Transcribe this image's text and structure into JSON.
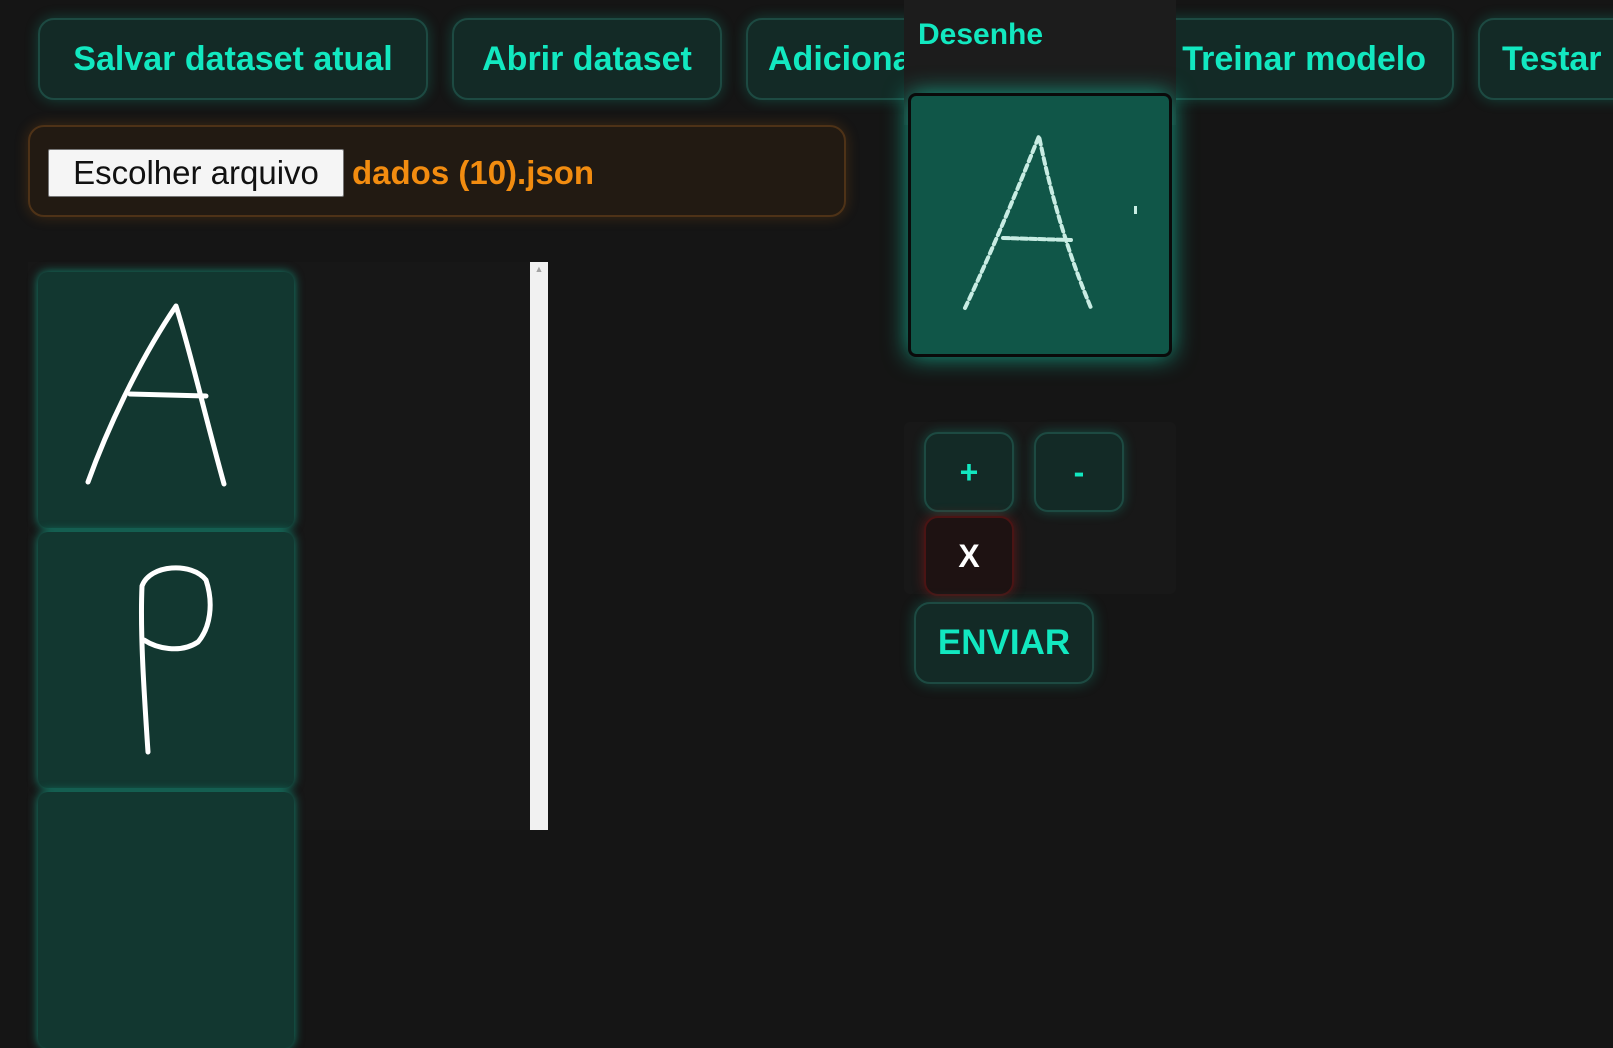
{
  "toolbar": {
    "save_dataset": "Salvar dataset atual",
    "open_dataset": "Abrir dataset",
    "add_drawing": "Adicionar desenho",
    "train_model": "Treinar modelo",
    "test": "Testar"
  },
  "file_input": {
    "button_label": "Escolher arquivo",
    "file_name": "dados (10).json"
  },
  "dataset_samples": [
    {
      "letter": "A"
    },
    {
      "letter": "P"
    },
    {
      "letter": ""
    }
  ],
  "draw_panel": {
    "title": "Desenhe",
    "controls": {
      "plus": "+",
      "minus": "-",
      "clear": "X"
    },
    "send": "ENVIAR"
  },
  "colors": {
    "accent": "#12e8c0",
    "background": "#151515",
    "button_bg": "#132a26",
    "file_accent": "#f28c10",
    "canvas_bg": "#105648",
    "clear_glow": "#dc1e1e"
  }
}
